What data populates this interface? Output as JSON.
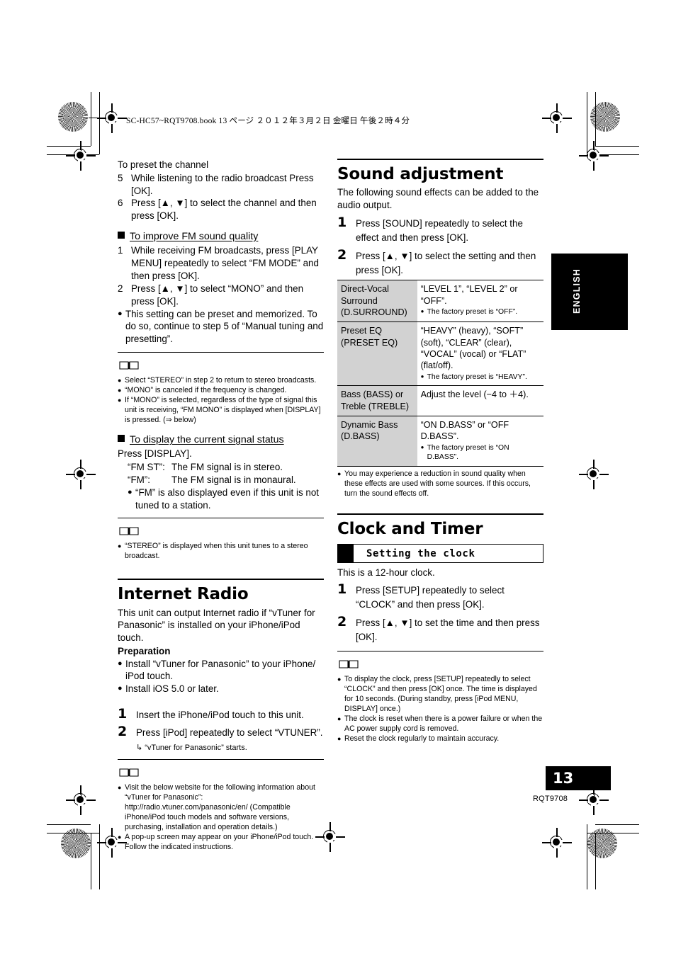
{
  "print_header": "SC-HC57~RQT9708.book  13 ページ  ２０１２年３月２日  金曜日  午後２時４分",
  "side_tab": {
    "label": "ENGLISH"
  },
  "footer": {
    "page_number": "13",
    "part_number": "RQT9708"
  },
  "left_column": {
    "preset_intro": "To preset the channel",
    "preset_steps": [
      {
        "n": "5",
        "text": "While listening to the radio broadcast Press [OK]."
      },
      {
        "n": "6",
        "text": "Press [▲, ▼] to select the channel and then press [OK]."
      }
    ],
    "fm_quality": {
      "heading": "To improve FM sound quality",
      "steps": [
        {
          "n": "1",
          "text": "While receiving FM broadcasts, press [PLAY MENU] repeatedly to select “FM MODE” and then press [OK]."
        },
        {
          "n": "2",
          "text": "Press [▲, ▼] to select “MONO” and then press [OK]."
        }
      ],
      "bullet": "This setting can be preset and memorized. To do so, continue to step 5 of “Manual tuning and presetting”."
    },
    "note1": [
      "Select “STEREO” in step 2 to return to stereo broadcasts.",
      "“MONO” is canceled if the frequency is changed.",
      "If “MONO” is selected, regardless of the type of signal this unit is receiving, “FM MONO” is displayed when [DISPLAY] is pressed. (⇒ below)"
    ],
    "signal_status": {
      "heading": "To display the current signal status",
      "press": "Press [DISPLAY].",
      "defs": [
        {
          "key": "“FM ST”:",
          "value": "The FM signal is in stereo."
        },
        {
          "key": "“FM”:",
          "value": "The FM signal is in monaural."
        }
      ],
      "bullet": "“FM” is also displayed even if this unit is not tuned to a station."
    },
    "note2": [
      "“STEREO” is displayed when this unit tunes to a stereo broadcast."
    ],
    "internet_radio": {
      "title": "Internet Radio",
      "intro": "This unit can output Internet radio if “vTuner for Panasonic” is installed on your iPhone/iPod touch.",
      "preparation_label": "Preparation",
      "preparation_bullets": [
        "Install “vTuner for Panasonic” to your iPhone/ iPod touch.",
        "Install iOS 5.0 or later."
      ],
      "steps": [
        {
          "n": "1",
          "text": "Insert the iPhone/iPod touch to this unit."
        },
        {
          "n": "2",
          "text": "Press [iPod] repeatedly to select “VTUNER”."
        }
      ],
      "arrow_note": "↳ “vTuner for Panasonic” starts."
    },
    "note3": [
      "Visit the below website for the following information about “vTuner for Panasonic”: http://radio.vtuner.com/panasonic/en/ (Compatible iPhone/iPod touch models and software versions, purchasing, installation and operation details.)",
      "A pop-up screen may appear on your iPhone/iPod touch. Follow the indicated instructions."
    ]
  },
  "right_column": {
    "sound_adjustment": {
      "title": "Sound adjustment",
      "intro": "The following sound effects can be added to the audio output.",
      "steps": [
        {
          "n": "1",
          "text": "Press [SOUND] repeatedly to select the effect and then press [OK]."
        },
        {
          "n": "2",
          "text": "Press [▲, ▼] to select the setting and then press [OK]."
        }
      ],
      "table": [
        {
          "key": "Direct-Vocal Surround (D.SURROUND)",
          "value": "“LEVEL 1”, “LEVEL 2” or “OFF”.",
          "note": "The factory preset is “OFF”."
        },
        {
          "key": "Preset EQ (PRESET EQ)",
          "value": "“HEAVY” (heavy), “SOFT” (soft), “CLEAR” (clear), “VOCAL” (vocal) or “FLAT” (flat/off).",
          "note": "The factory preset is “HEAVY”."
        },
        {
          "key": "Bass (BASS) or Treble (TREBLE)",
          "value": "Adjust the level (−4 to ＋4).",
          "note": ""
        },
        {
          "key": "Dynamic Bass (D.BASS)",
          "value": "“ON D.BASS” or “OFF D.BASS”.",
          "note": "The factory preset is “ON D.BASS”."
        }
      ],
      "after_table_bullet": "You may experience a reduction in sound quality when these effects are used with some sources. If this occurs, turn the sound effects off."
    },
    "clock_and_timer": {
      "title": "Clock and Timer",
      "box_label": "Setting the clock",
      "intro": "This is a 12-hour clock.",
      "steps": [
        {
          "n": "1",
          "text": "Press [SETUP] repeatedly to select “CLOCK” and then press [OK]."
        },
        {
          "n": "2",
          "text": "Press [▲, ▼] to set the time and then press [OK]."
        }
      ],
      "notes": [
        "To display the clock, press [SETUP] repeatedly to select “CLOCK” and then press [OK] once. The time is displayed for 10 seconds. (During standby, press [iPod MENU, DISPLAY] once.)",
        "The clock is reset when there is a power failure or when the AC power supply cord is removed.",
        "Reset the clock regularly to maintain accuracy."
      ]
    }
  }
}
